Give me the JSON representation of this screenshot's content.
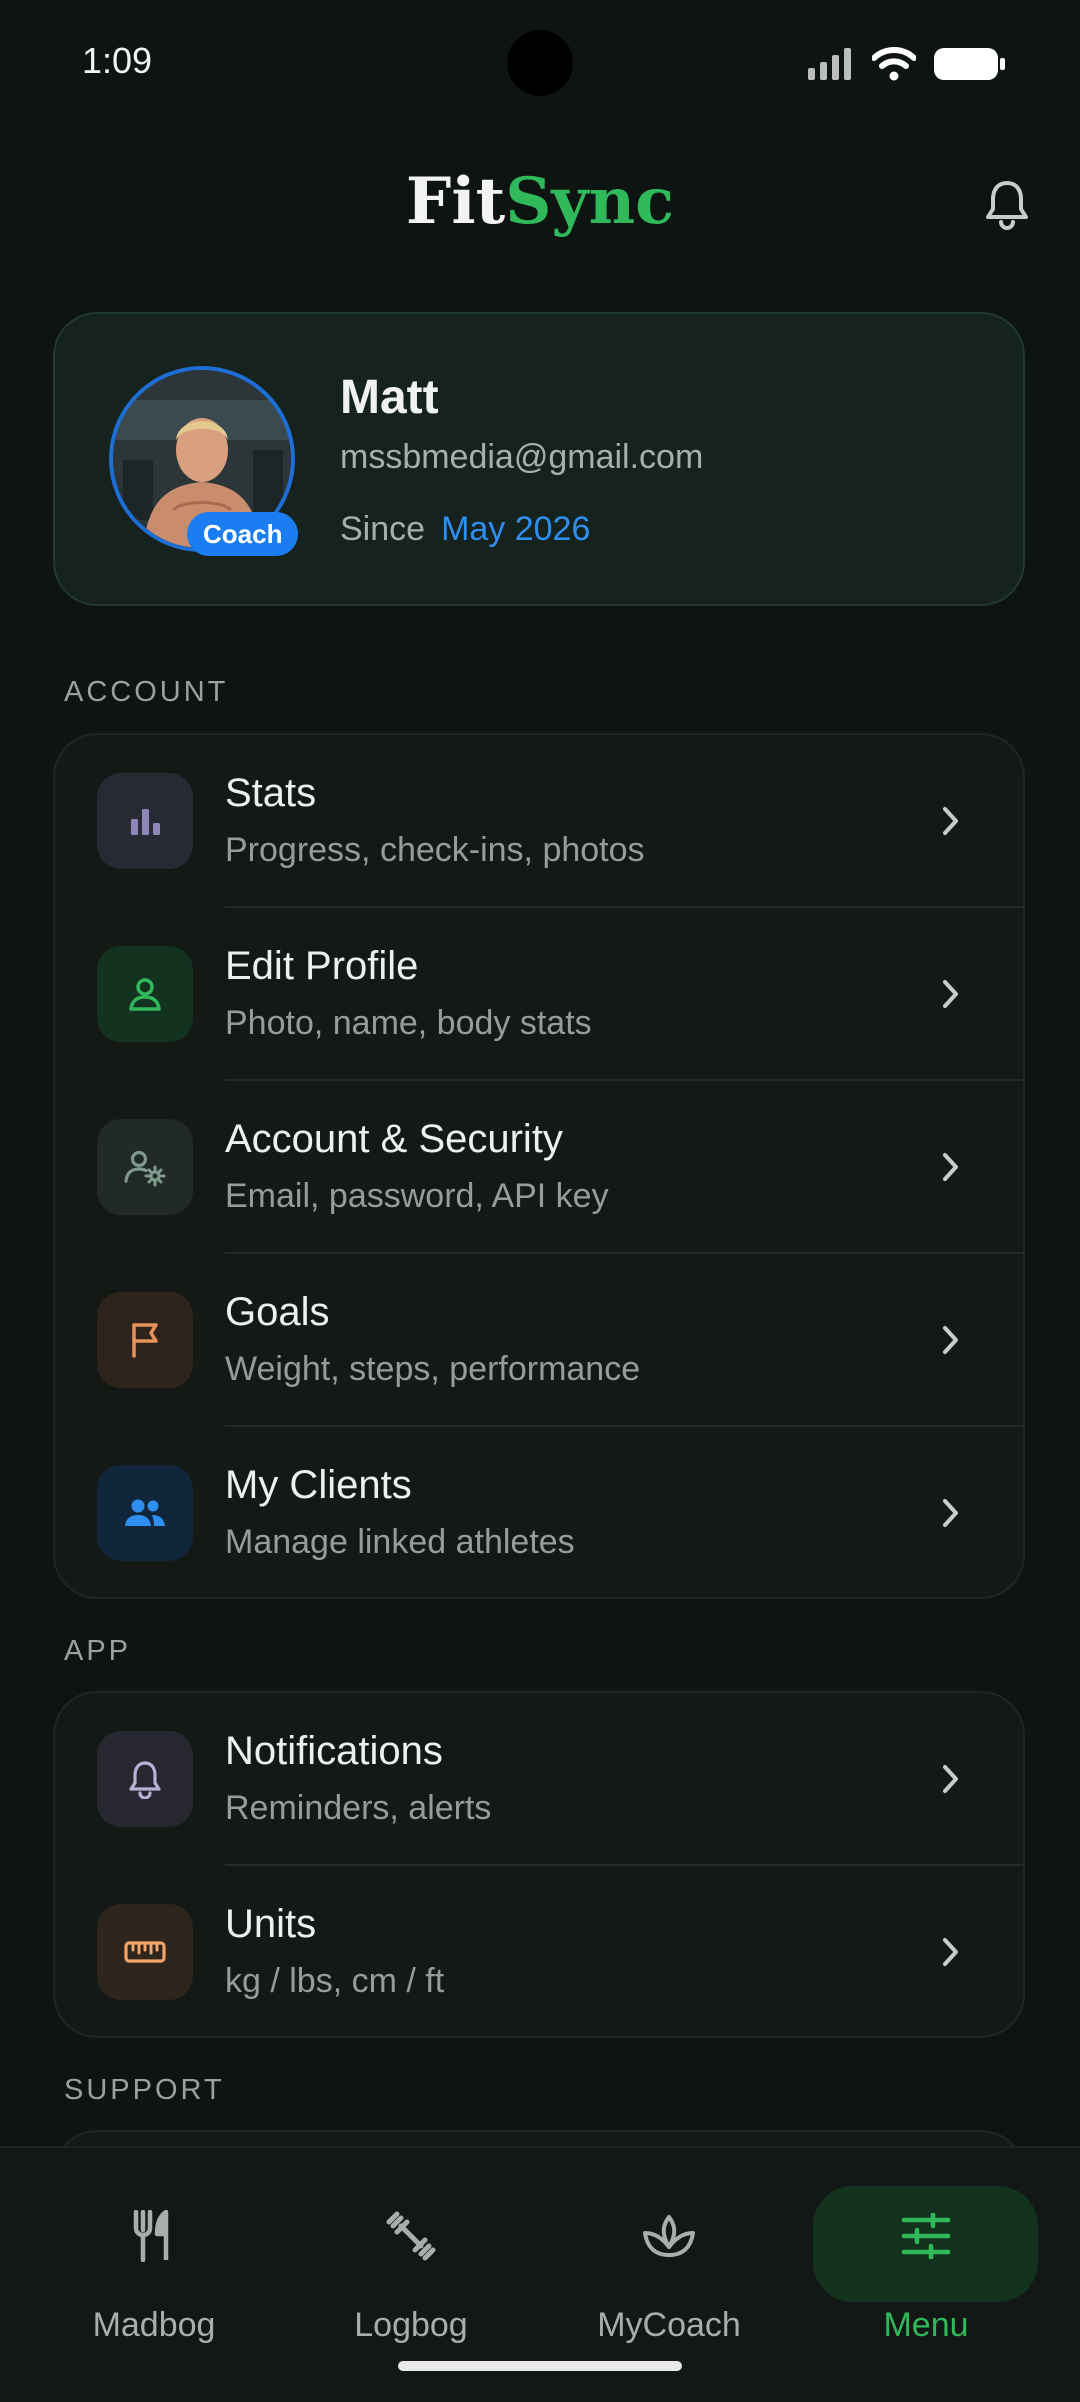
{
  "status": {
    "time": "1:09"
  },
  "header": {
    "logo_part1": "Fit",
    "logo_part2": "Sync"
  },
  "profile": {
    "name": "Matt",
    "email": "mssbmedia@gmail.com",
    "since_label": "Since",
    "since_date": "May 2026",
    "badge": "Coach"
  },
  "sections": {
    "account": "ACCOUNT",
    "app": "APP",
    "support": "SUPPORT"
  },
  "account_items": [
    {
      "title": "Stats",
      "subtitle": "Progress, check-ins, photos",
      "icon": "bar-chart-icon",
      "color": "#8e86b8"
    },
    {
      "title": "Edit Profile",
      "subtitle": "Photo, name, body stats",
      "icon": "user-icon",
      "color": "#2fb95a"
    },
    {
      "title": "Account & Security",
      "subtitle": "Email, password, API key",
      "icon": "user-gear-icon",
      "color": "#7f9a8d"
    },
    {
      "title": "Goals",
      "subtitle": "Weight, steps, performance",
      "icon": "flag-icon",
      "color": "#e8935a"
    },
    {
      "title": "My Clients",
      "subtitle": "Manage linked athletes",
      "icon": "users-icon",
      "color": "#2f8ff0"
    }
  ],
  "app_items": [
    {
      "title": "Notifications",
      "subtitle": "Reminders, alerts",
      "icon": "bell-icon",
      "color": "#b7b0d8"
    },
    {
      "title": "Units",
      "subtitle": "kg / lbs, cm / ft",
      "icon": "ruler-icon",
      "color": "#f0a56a"
    }
  ],
  "nav": [
    {
      "label": "Madbog",
      "icon": "fork-knife-icon"
    },
    {
      "label": "Logbog",
      "icon": "dumbbell-icon"
    },
    {
      "label": "MyCoach",
      "icon": "lotus-icon"
    },
    {
      "label": "Menu",
      "icon": "sliders-icon",
      "active": true
    }
  ],
  "colors": {
    "accent": "#2fb95a",
    "link": "#2f8ff0",
    "background": "#0d1411"
  }
}
